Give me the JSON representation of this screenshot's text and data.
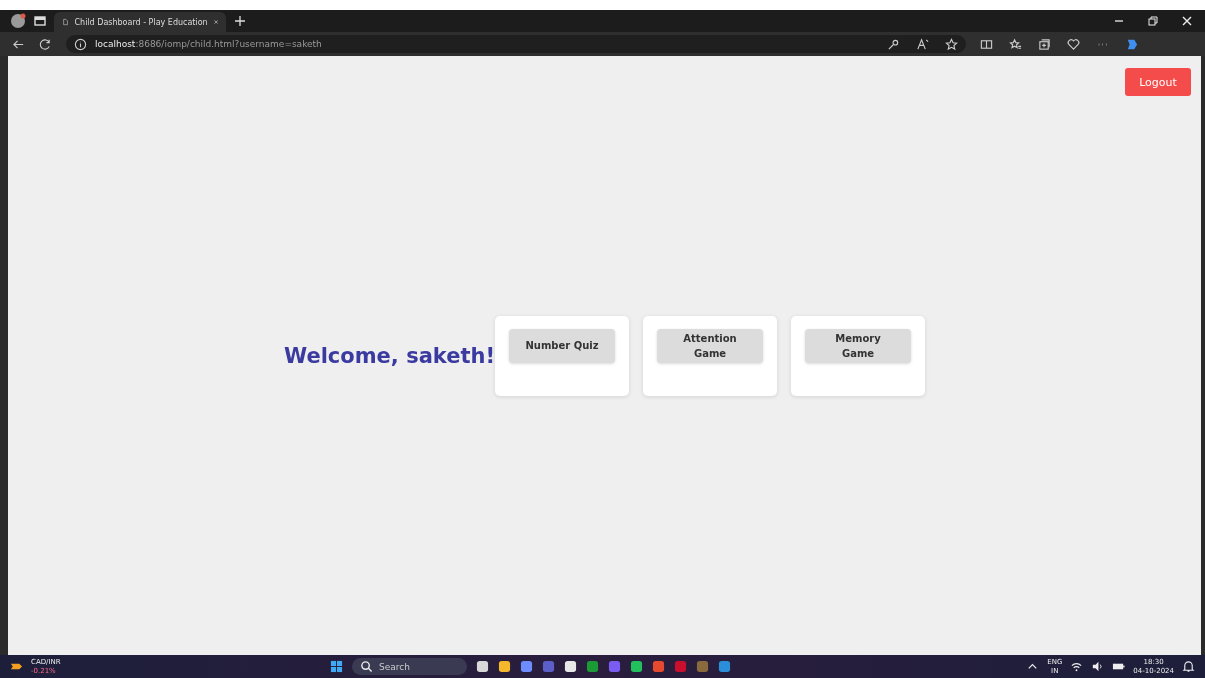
{
  "browser": {
    "tab_title": "Child Dashboard - Play Education",
    "url_host": "localhost",
    "url_path": ":8686/iomp/child.html?username=saketh"
  },
  "page": {
    "logout": "Logout",
    "welcome": "Welcome, saketh!",
    "games": [
      "Number Quiz",
      "Attention Game",
      "Memory Game"
    ]
  },
  "taskbar": {
    "widget_title": "CAD/INR",
    "widget_value": "-0.21%",
    "search_placeholder": "Search",
    "language": "ENG",
    "region": "IN",
    "time": "18:30",
    "date": "04-10-2024"
  }
}
